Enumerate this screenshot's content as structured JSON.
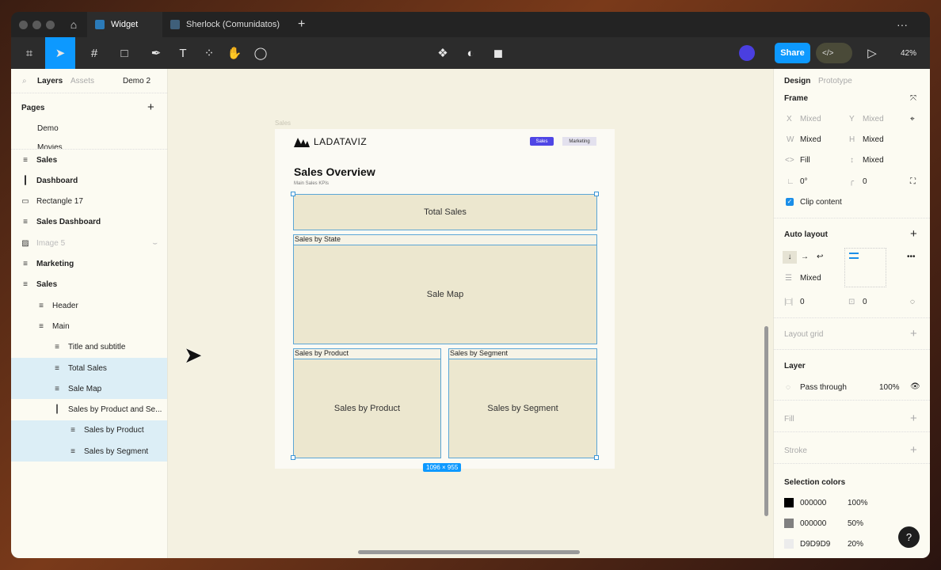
{
  "tabs": {
    "home": "home-icon",
    "items": [
      {
        "label": "Widget",
        "active": true
      },
      {
        "label": "Sherlock (Comunidatos)",
        "active": false
      }
    ],
    "more": "···"
  },
  "toolbar": {
    "share": "Share",
    "zoom": "42%",
    "code": "</>"
  },
  "left": {
    "tab_layers": "Layers",
    "tab_assets": "Assets",
    "page_select": "Demo 2",
    "pages_title": "Pages",
    "pages": [
      "Demo",
      "Movies"
    ],
    "layers": [
      {
        "label": "Sales",
        "icon": "≡",
        "bold": true,
        "indent": 0
      },
      {
        "label": "Dashboard",
        "icon": "┃",
        "bold": true,
        "indent": 0
      },
      {
        "label": "Rectangle 17",
        "icon": "▭",
        "bold": false,
        "indent": 0
      },
      {
        "label": "Sales Dashboard",
        "icon": "≡",
        "bold": true,
        "indent": 0
      },
      {
        "label": "Image 5",
        "icon": "▨",
        "bold": false,
        "indent": 0,
        "hidden": true
      },
      {
        "label": "Marketing",
        "icon": "≡",
        "bold": true,
        "indent": 0
      },
      {
        "label": "Sales",
        "icon": "≡",
        "bold": true,
        "indent": 0
      },
      {
        "label": "Header",
        "icon": "≡",
        "bold": false,
        "indent": 1
      },
      {
        "label": "Main",
        "icon": "≡",
        "bold": false,
        "indent": 1
      },
      {
        "label": "Title and subtitle",
        "icon": "≡",
        "bold": false,
        "indent": 2
      },
      {
        "label": "Total Sales",
        "icon": "≡",
        "bold": false,
        "indent": 2,
        "hl": true
      },
      {
        "label": "Sale Map",
        "icon": "≡",
        "bold": false,
        "indent": 2,
        "hl": true
      },
      {
        "label": "Sales by Product and Se...",
        "icon": "┃",
        "bold": false,
        "indent": 2
      },
      {
        "label": "Sales by Product",
        "icon": "≡",
        "bold": false,
        "indent": 3,
        "hl": true
      },
      {
        "label": "Sales by Segment",
        "icon": "≡",
        "bold": false,
        "indent": 3,
        "hl": true
      }
    ]
  },
  "canvas": {
    "frame_label": "Sales",
    "logo": "LADATAVIZ",
    "nav": [
      "Sales",
      "Marketing"
    ],
    "title": "Sales Overview",
    "subtitle": "Main Sales KPIs",
    "total_sales": "Total Sales",
    "state_header": "Sales by State",
    "map": "Sale Map",
    "product_header": "Sales by Product",
    "product": "Sales by Product",
    "segment_header": "Sales by Segment",
    "segment": "Sales by Segment",
    "size_badge": "1096 × 955"
  },
  "right": {
    "tab_design": "Design",
    "tab_prototype": "Prototype",
    "frame": "Frame",
    "x_label": "X",
    "x": "Mixed",
    "y_label": "Y",
    "y": "Mixed",
    "w_label": "W",
    "w": "Mixed",
    "h_label": "H",
    "h": "Mixed",
    "hsize": "Fill",
    "vsize": "Mixed",
    "rotation": "0°",
    "radius": "0",
    "clip": "Clip content",
    "auto_layout": "Auto layout",
    "gap": "Mixed",
    "pad_h": "0",
    "pad_v": "0",
    "layout_grid": "Layout grid",
    "layer": "Layer",
    "blend": "Pass through",
    "opacity": "100%",
    "fill": "Fill",
    "stroke": "Stroke",
    "selection_colors": "Selection colors",
    "colors": [
      {
        "hex": "000000",
        "opacity": "100%",
        "swatch": "#000000"
      },
      {
        "hex": "000000",
        "opacity": "50%",
        "swatch": "#808080"
      },
      {
        "hex": "D9D9D9",
        "opacity": "20%",
        "swatch": "#ececec"
      }
    ],
    "help": "?"
  },
  "colors": {
    "accent": "#0d99ff",
    "nav_active": "#4f46e5",
    "selection": "#5ba6d6"
  }
}
